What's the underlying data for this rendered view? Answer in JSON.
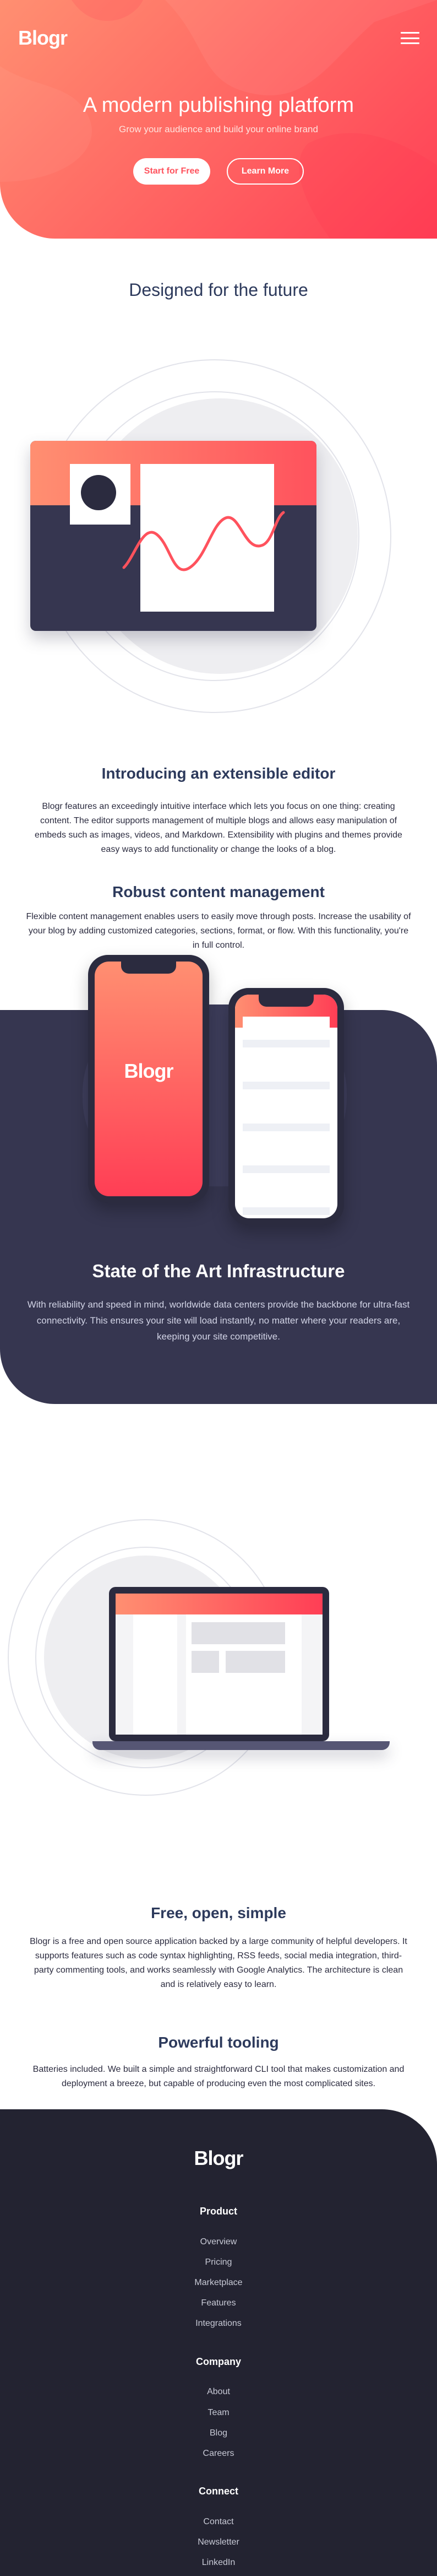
{
  "brand": {
    "logo": "Blogr"
  },
  "colors": {
    "accent_light": "#ff8f71",
    "accent_dark": "#ff3e55",
    "navy": "#363650",
    "footer": "#232331",
    "heading": "#2d3a5c"
  },
  "header": {
    "menu_icon": "hamburger-icon"
  },
  "hero": {
    "title": "A modern publishing platform",
    "subtitle": "Grow your audience and build your online brand",
    "primary_button": "Start for Free",
    "secondary_button": "Learn More"
  },
  "designed": {
    "title": "Designed for the future",
    "editor": {
      "title": "Introducing an extensible editor",
      "text": "Blogr features an exceedingly intuitive interface which lets you focus on one thing: creating content. The editor supports management of multiple blogs and allows easy manipulation of embeds such as images, videos, and Markdown. Extensibility with plugins and themes provide easy ways to add functionality or change the looks of a blog."
    },
    "content": {
      "title": "Robust content management",
      "text": "Flexible content management enables users to easily move through posts. Increase the usability of your blog by adding customized categories, sections, format, or flow. With this functionality, you're in full control."
    }
  },
  "phone": {
    "screen_logo": "Blogr"
  },
  "infra": {
    "title": "State of the Art Infrastructure",
    "text": "With reliability and speed in mind, worldwide data centers provide the backbone for ultra-fast connectivity. This ensures your site will load instantly, no matter where your readers are, keeping your site competitive."
  },
  "features": {
    "free": {
      "title": "Free, open, simple",
      "text": "Blogr is a free and open source application backed by a large community of helpful developers. It supports features such as code syntax highlighting, RSS feeds, social media integration, third-party commenting tools, and works seamlessly with Google Analytics. The architecture is clean and is relatively easy to learn."
    },
    "tooling": {
      "title": "Powerful tooling",
      "text": "Batteries included. We built a simple and straightforward CLI tool that makes customization and deployment a breeze, but capable of producing even the most complicated sites."
    }
  },
  "footer": {
    "logo": "Blogr",
    "columns": [
      {
        "title": "Product",
        "links": [
          "Overview",
          "Pricing",
          "Marketplace",
          "Features",
          "Integrations"
        ]
      },
      {
        "title": "Company",
        "links": [
          "About",
          "Team",
          "Blog",
          "Careers"
        ]
      },
      {
        "title": "Connect",
        "links": [
          "Contact",
          "Newsletter",
          "LinkedIn"
        ]
      }
    ]
  }
}
